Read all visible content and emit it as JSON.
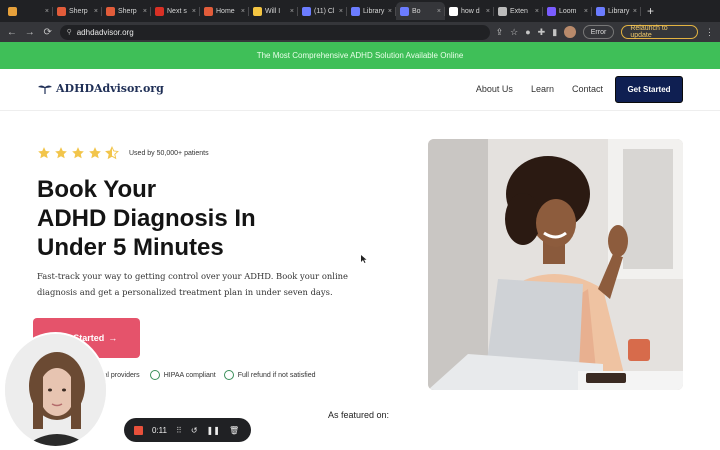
{
  "browser": {
    "tabs": [
      {
        "label": "",
        "color": "#e7a13b"
      },
      {
        "label": "Sherp",
        "color": "#e25c3a"
      },
      {
        "label": "Sherp",
        "color": "#e25c3a"
      },
      {
        "label": "Next s",
        "color": "#d93025"
      },
      {
        "label": "Home",
        "color": "#e25c3a"
      },
      {
        "label": "Will I",
        "color": "#f4c542"
      },
      {
        "label": "(11) Cl",
        "color": "#6b7cff"
      },
      {
        "label": "Library",
        "color": "#6b7cff"
      },
      {
        "label": "Bo",
        "color": "#6b7cff",
        "active": true
      },
      {
        "label": "how d",
        "color": "#ffffff"
      },
      {
        "label": "Exten",
        "color": "#bbbbbb"
      },
      {
        "label": "Loom",
        "color": "#7a5cff"
      },
      {
        "label": "Library",
        "color": "#6b7cff"
      }
    ],
    "new_tab": "+",
    "url": "adhdadvisor.org",
    "error_label": "Error",
    "relaunch_label": "Relaunch to update"
  },
  "announcement": "The Most Comprehensive ADHD Solution Available Online",
  "nav": {
    "logo_text": "ADHDAdvisor.org",
    "links": [
      "About Us",
      "Learn",
      "Contact"
    ],
    "cta": "Get Started"
  },
  "hero": {
    "rating": {
      "value": 4.5,
      "max": 5
    },
    "used_by": "Used by 50,000+ patients",
    "headline": [
      "Book Your",
      "ADHD Diagnosis In",
      "Under 5 Minutes"
    ],
    "subtext": "Fast-track your way to getting control over your ADHD. Book your online diagnosis and get a personalized treatment plan in under seven days.",
    "cta": "Get Started",
    "trust": [
      "cal providers",
      "HIPAA compliant",
      "Full refund if not satisfied"
    ],
    "featured_label": "As featured on:"
  },
  "recorder": {
    "time": "0:11"
  },
  "colors": {
    "announcement_bg": "#3fbf58",
    "brand_navy": "#0f1f52",
    "cta_pink": "#e5536b",
    "star": "#f2c54b"
  }
}
